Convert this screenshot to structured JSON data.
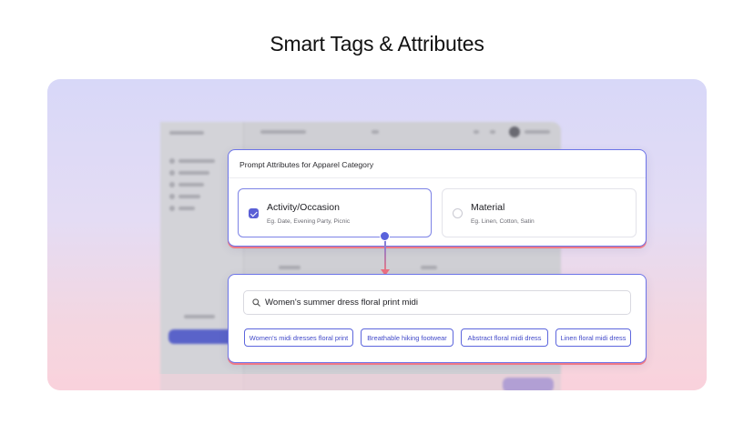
{
  "page": {
    "title": "Smart Tags & Attributes"
  },
  "prompt_panel": {
    "header": "Prompt Attributes for Apparel Category",
    "options": [
      {
        "label": "Activity/Occasion",
        "examples": "Eg. Date, Evening Party, Picnic",
        "checked": true
      },
      {
        "label": "Material",
        "examples": "Eg. Linen, Cotton, Satin",
        "checked": false
      }
    ]
  },
  "search_panel": {
    "query": "Women's summer dress floral print midi",
    "tags": [
      "Women's midi dresses floral print",
      "Breathable hiking footwear",
      "Abstract floral midi dress",
      "Linen floral midi dress"
    ]
  },
  "colors": {
    "accent": "#5a5fd6",
    "connector_end": "#ec6f80"
  },
  "icons": [
    "search-icon",
    "check-icon"
  ]
}
